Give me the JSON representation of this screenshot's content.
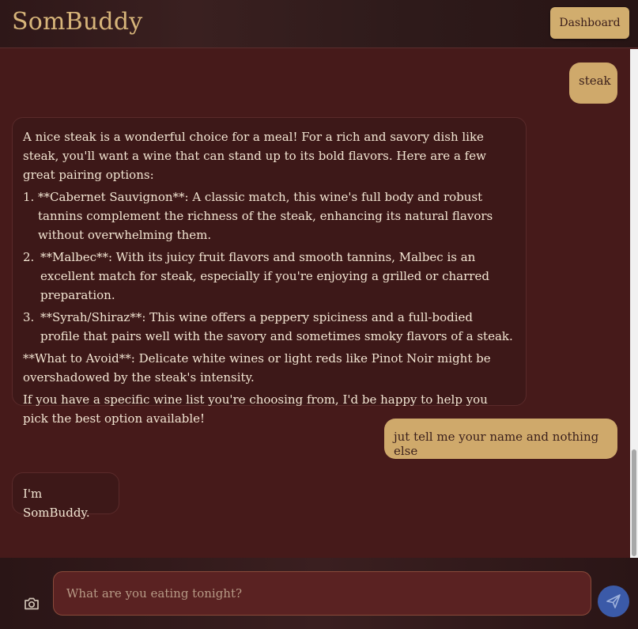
{
  "header": {
    "brand": "SomBuddy",
    "dashboard_label": "Dashboard"
  },
  "messages": {
    "m1_user": "steak",
    "m2_bot": {
      "intro": "A nice steak is a wonderful choice for a meal! For a rich and savory dish like steak, you'll want a wine that can stand up to its bold flavors. Here are a few great pairing options:",
      "items": [
        {
          "num": "1.",
          "text": "**Cabernet Sauvignon**: A classic match, this wine's full body and robust tannins complement the richness of the steak, enhancing its natural flavors without overwhelming them."
        },
        {
          "num": "2.",
          "text": "**Malbec**: With its juicy fruit flavors and smooth tannins, Malbec is an excellent match for steak, especially if you're enjoying a grilled or charred preparation."
        },
        {
          "num": "3.",
          "text": "**Syrah/Shiraz**: This wine offers a peppery spiciness and a full-bodied profile that pairs well with the savory and sometimes smoky flavors of a steak."
        }
      ],
      "avoid": "**What to Avoid**: Delicate white wines or light reds like Pinot Noir might be overshadowed by the steak's intensity.",
      "closing": "If you have a specific wine list you're choosing from, I'd be happy to help you pick the best option available!"
    },
    "m3_user": "jut tell me your name and nothing else",
    "m4_bot": "I'm SomBuddy."
  },
  "composer": {
    "placeholder": "What are you eating tonight?",
    "value": "",
    "camera_icon": "camera-icon",
    "send_icon": "send-icon"
  },
  "colors": {
    "background": "#461a1a",
    "accent": "#cfa96b",
    "send": "#3b5aa8"
  }
}
